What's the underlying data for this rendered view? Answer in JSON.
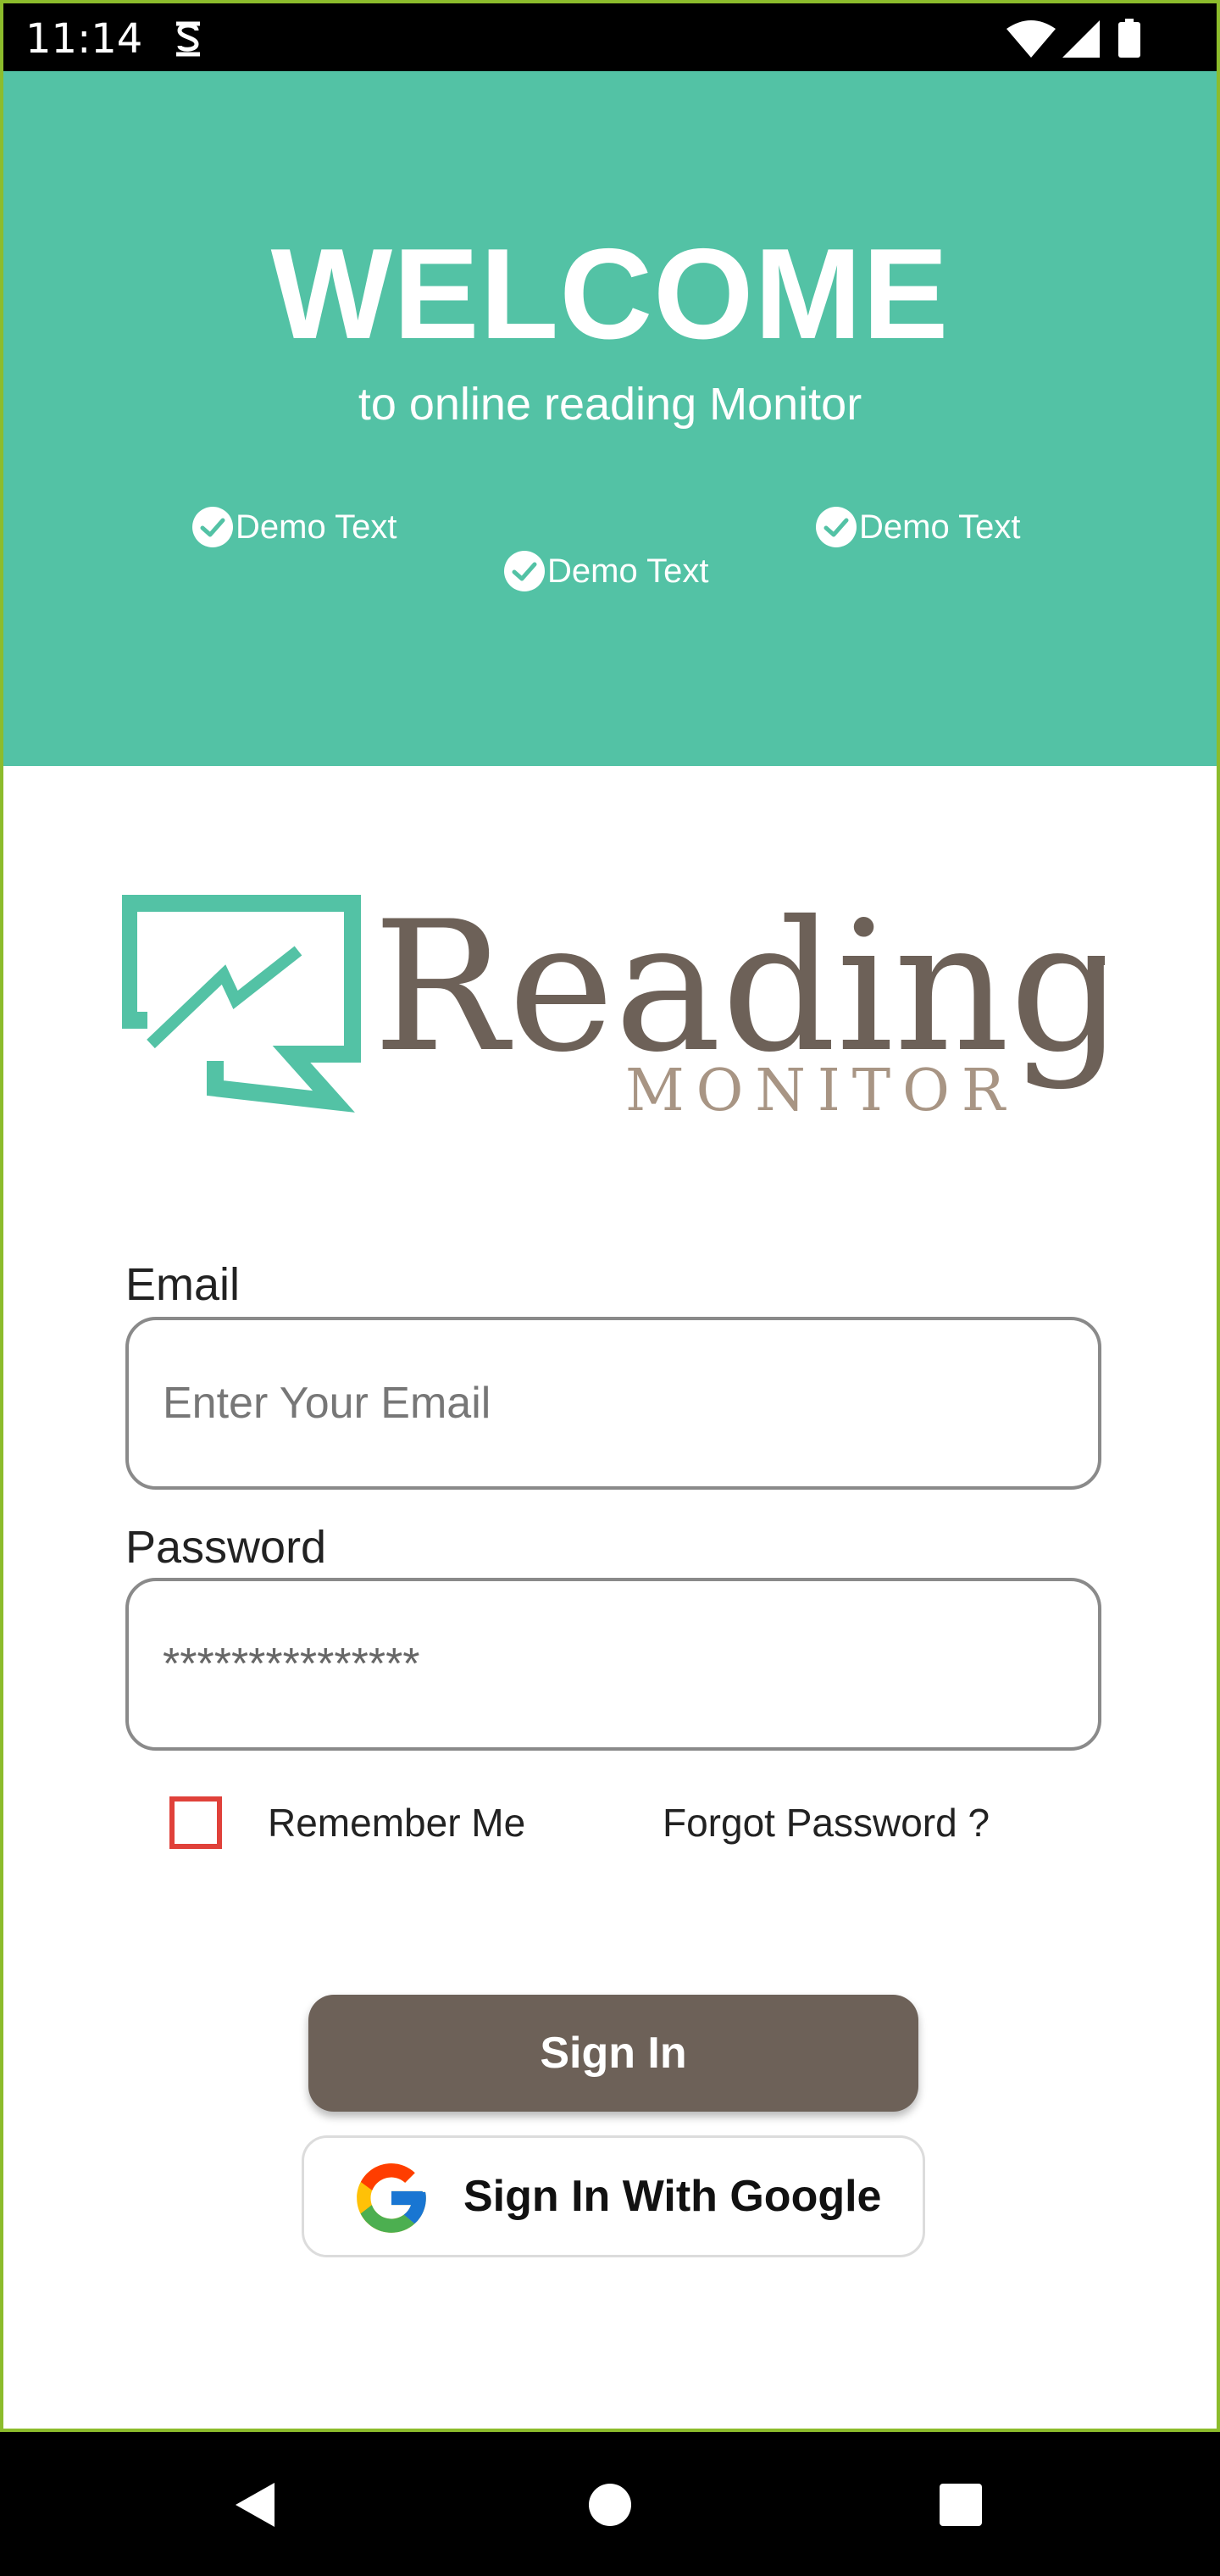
{
  "status_bar": {
    "time": "11:14",
    "icons": [
      "sim-icon",
      "wifi-icon",
      "signal-icon",
      "battery-icon"
    ]
  },
  "hero": {
    "title": "WELCOME",
    "subtitle": "to online reading Monitor",
    "features": [
      "Demo Text",
      "Demo Text",
      "Demo Text"
    ],
    "background_color": "#53c2a5"
  },
  "logo": {
    "word": "Reading",
    "tagline": "MONITOR",
    "teal_color": "#53c2a5",
    "brown_color": "#6d6158",
    "tan_color": "#a89584"
  },
  "form": {
    "email_label": "Email",
    "email_placeholder": "Enter Your Email",
    "password_label": "Password",
    "password_value": "***************",
    "remember_label": "Remember Me",
    "forgot_label": "Forgot Password ?"
  },
  "buttons": {
    "signin_label": "Sign In",
    "google_label": "Sign In With Google",
    "signin_color": "#6d6158"
  },
  "nav_bar": {
    "icons": [
      "back-icon",
      "home-icon",
      "recents-icon"
    ]
  }
}
